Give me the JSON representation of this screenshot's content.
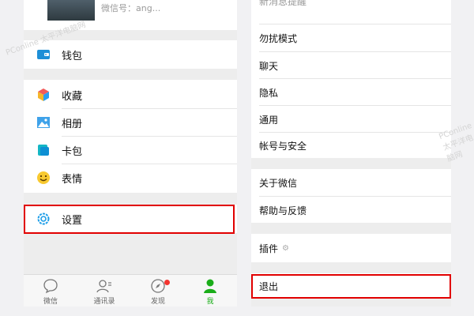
{
  "left": {
    "profile_id": "微信号：ang...",
    "wallet": "钱包",
    "favorites": "收藏",
    "album": "相册",
    "cards": "卡包",
    "stickers": "表情",
    "settings": "设置",
    "tabs": [
      {
        "label": "微信",
        "icon": "chat-icon"
      },
      {
        "label": "通讯录",
        "icon": "contacts-icon"
      },
      {
        "label": "发现",
        "icon": "compass-icon"
      },
      {
        "label": "我",
        "icon": "person-icon"
      }
    ]
  },
  "right": {
    "top_partial": "新消息提醒",
    "do_not_disturb": "勿扰模式",
    "chat": "聊天",
    "privacy": "隐私",
    "general": "通用",
    "account_security": "帐号与安全",
    "about": "关于微信",
    "help_feedback": "帮助与反馈",
    "plugins": "插件",
    "logout": "退出"
  },
  "watermark": "PConline 太平洋电脑网",
  "colors": {
    "accent_green": "#1aad19",
    "highlight_red": "#e10000",
    "badge_red": "#f43530"
  }
}
